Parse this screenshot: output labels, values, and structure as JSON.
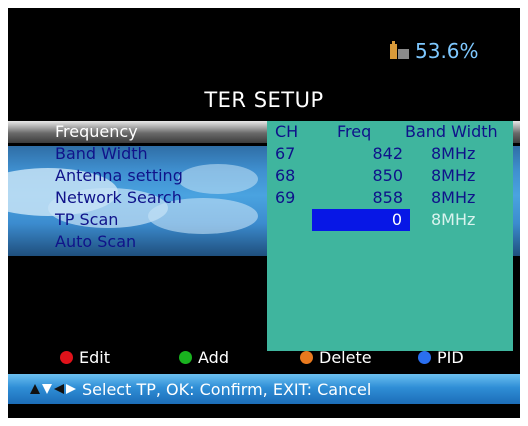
{
  "status": {
    "battery_text": "53.6%"
  },
  "title": "TER SETUP",
  "menu": {
    "items": [
      {
        "label": "Frequency",
        "selected": true
      },
      {
        "label": "Band Width"
      },
      {
        "label": "Antenna setting"
      },
      {
        "label": "Network Search"
      },
      {
        "label": "TP Scan"
      },
      {
        "label": "Auto Scan"
      }
    ]
  },
  "table": {
    "headers": {
      "ch": "CH",
      "freq": "Freq",
      "bw": "Band Width"
    },
    "rows": [
      {
        "ch": "67",
        "freq": "842",
        "bw": "8MHz"
      },
      {
        "ch": "68",
        "freq": "850",
        "bw": "8MHz"
      },
      {
        "ch": "69",
        "freq": "858",
        "bw": "8MHz"
      }
    ],
    "edit_row": {
      "freq": "0",
      "bw": "8MHz"
    }
  },
  "legend": {
    "edit": {
      "label": "Edit",
      "color": "#e0121a"
    },
    "add": {
      "label": "Add",
      "color": "#19b21f"
    },
    "delete": {
      "label": "Delete",
      "color": "#e8791e"
    },
    "pid": {
      "label": "PID",
      "color": "#2a6ff0"
    }
  },
  "help": {
    "text": "Select TP, OK: Confirm, EXIT: Cancel",
    "icon": "direction-arrows-icon"
  }
}
